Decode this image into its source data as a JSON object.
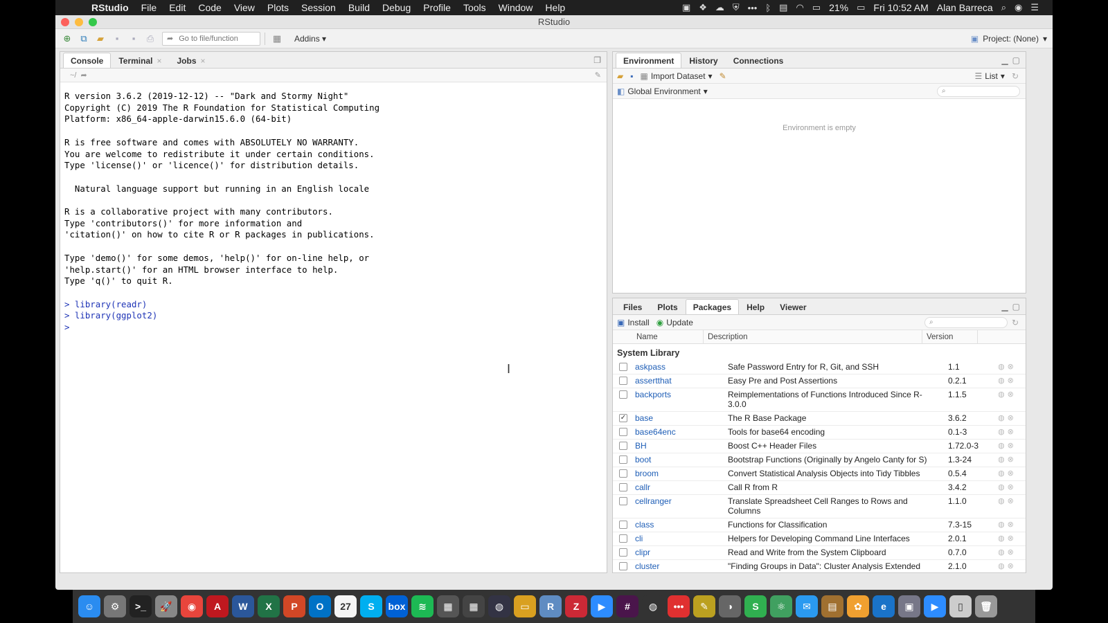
{
  "menubar": {
    "app": "RStudio",
    "items": [
      "File",
      "Edit",
      "Code",
      "View",
      "Plots",
      "Session",
      "Build",
      "Debug",
      "Profile",
      "Tools",
      "Window",
      "Help"
    ],
    "battery": "21%",
    "clock": "Fri 10:52 AM",
    "user": "Alan Barreca"
  },
  "window": {
    "title": "RStudio"
  },
  "toolbar": {
    "goto_placeholder": "Go to file/function",
    "addins": "Addins",
    "project": "Project: (None)"
  },
  "console": {
    "tabs": [
      {
        "label": "Console",
        "closable": false
      },
      {
        "label": "Terminal",
        "closable": true
      },
      {
        "label": "Jobs",
        "closable": true
      }
    ],
    "path": "~/",
    "startup_lines": [
      "R version 3.6.2 (2019-12-12) -- \"Dark and Stormy Night\"",
      "Copyright (C) 2019 The R Foundation for Statistical Computing",
      "Platform: x86_64-apple-darwin15.6.0 (64-bit)",
      "",
      "R is free software and comes with ABSOLUTELY NO WARRANTY.",
      "You are welcome to redistribute it under certain conditions.",
      "Type 'license()' or 'licence()' for distribution details.",
      "",
      "  Natural language support but running in an English locale",
      "",
      "R is a collaborative project with many contributors.",
      "Type 'contributors()' for more information and",
      "'citation()' on how to cite R or R packages in publications.",
      "",
      "Type 'demo()' for some demos, 'help()' for on-line help, or",
      "'help.start()' for an HTML browser interface to help.",
      "Type 'q()' to quit R.",
      ""
    ],
    "commands": [
      "> library(readr)",
      "> library(ggplot2)",
      ">"
    ]
  },
  "environment": {
    "tabs": [
      "Environment",
      "History",
      "Connections"
    ],
    "import_dataset": "Import Dataset",
    "view_mode": "List",
    "scope": "Global Environment",
    "empty_message": "Environment is empty"
  },
  "packages": {
    "tabs": [
      "Files",
      "Plots",
      "Packages",
      "Help",
      "Viewer"
    ],
    "install": "Install",
    "update": "Update",
    "columns": [
      "Name",
      "Description",
      "Version"
    ],
    "section": "System Library",
    "rows": [
      {
        "name": "askpass",
        "desc": "Safe Password Entry for R, Git, and SSH",
        "ver": "1.1",
        "checked": false
      },
      {
        "name": "assertthat",
        "desc": "Easy Pre and Post Assertions",
        "ver": "0.2.1",
        "checked": false
      },
      {
        "name": "backports",
        "desc": "Reimplementations of Functions Introduced Since R-3.0.0",
        "ver": "1.1.5",
        "checked": false
      },
      {
        "name": "base",
        "desc": "The R Base Package",
        "ver": "3.6.2",
        "checked": true
      },
      {
        "name": "base64enc",
        "desc": "Tools for base64 encoding",
        "ver": "0.1-3",
        "checked": false
      },
      {
        "name": "BH",
        "desc": "Boost C++ Header Files",
        "ver": "1.72.0-3",
        "checked": false
      },
      {
        "name": "boot",
        "desc": "Bootstrap Functions (Originally by Angelo Canty for S)",
        "ver": "1.3-24",
        "checked": false
      },
      {
        "name": "broom",
        "desc": "Convert Statistical Analysis Objects into Tidy Tibbles",
        "ver": "0.5.4",
        "checked": false
      },
      {
        "name": "callr",
        "desc": "Call R from R",
        "ver": "3.4.2",
        "checked": false
      },
      {
        "name": "cellranger",
        "desc": "Translate Spreadsheet Cell Ranges to Rows and Columns",
        "ver": "1.1.0",
        "checked": false
      },
      {
        "name": "class",
        "desc": "Functions for Classification",
        "ver": "7.3-15",
        "checked": false
      },
      {
        "name": "cli",
        "desc": "Helpers for Developing Command Line Interfaces",
        "ver": "2.0.1",
        "checked": false
      },
      {
        "name": "clipr",
        "desc": "Read and Write from the System Clipboard",
        "ver": "0.7.0",
        "checked": false
      },
      {
        "name": "cluster",
        "desc": "\"Finding Groups in Data\": Cluster Analysis Extended",
        "ver": "2.1.0",
        "checked": false
      }
    ]
  },
  "dock": {
    "apps": [
      {
        "name": "finder",
        "glyph": "☺",
        "color": "#2a8cf0"
      },
      {
        "name": "system-preferences",
        "glyph": "⚙",
        "color": "#777"
      },
      {
        "name": "terminal",
        "glyph": ">_",
        "color": "#222"
      },
      {
        "name": "launchpad",
        "glyph": "🚀",
        "color": "#888"
      },
      {
        "name": "chrome",
        "glyph": "◉",
        "color": "#e8453c"
      },
      {
        "name": "acrobat",
        "glyph": "A",
        "color": "#c0181f"
      },
      {
        "name": "word",
        "glyph": "W",
        "color": "#2b579a"
      },
      {
        "name": "excel",
        "glyph": "X",
        "color": "#217346"
      },
      {
        "name": "powerpoint",
        "glyph": "P",
        "color": "#d24726"
      },
      {
        "name": "outlook",
        "glyph": "O",
        "color": "#0072c6"
      },
      {
        "name": "calendar",
        "glyph": "27",
        "color": "#f5f5f5"
      },
      {
        "name": "skype",
        "glyph": "S",
        "color": "#00aff0"
      },
      {
        "name": "box",
        "glyph": "box",
        "color": "#0061d5"
      },
      {
        "name": "spotify",
        "glyph": "≋",
        "color": "#1db954"
      },
      {
        "name": "grid-app",
        "glyph": "▦",
        "color": "#555"
      },
      {
        "name": "grid-app-2",
        "glyph": "▦",
        "color": "#444"
      },
      {
        "name": "globe",
        "glyph": "◍",
        "color": "#334"
      },
      {
        "name": "bus",
        "glyph": "▭",
        "color": "#d9a020"
      },
      {
        "name": "r-app",
        "glyph": "R",
        "color": "#5f8cc2"
      },
      {
        "name": "zotero",
        "glyph": "Z",
        "color": "#cc2936"
      },
      {
        "name": "zoom",
        "glyph": "▶",
        "color": "#2d8cff"
      },
      {
        "name": "slack",
        "glyph": "#",
        "color": "#4a154b"
      },
      {
        "name": "globe-2",
        "glyph": "◍",
        "color": "#333"
      },
      {
        "name": "dots",
        "glyph": "•••",
        "color": "#e03030"
      },
      {
        "name": "pen",
        "glyph": "✎",
        "color": "#bba020"
      },
      {
        "name": "switch",
        "glyph": "◑",
        "color": "#666"
      },
      {
        "name": "s-app",
        "glyph": "S",
        "color": "#30b050"
      },
      {
        "name": "atom",
        "glyph": "⚛",
        "color": "#40a060"
      },
      {
        "name": "messages",
        "glyph": "✉",
        "color": "#2a9af0"
      },
      {
        "name": "notes",
        "glyph": "▤",
        "color": "#a07030"
      },
      {
        "name": "photos",
        "glyph": "✿",
        "color": "#f0a030"
      },
      {
        "name": "edge",
        "glyph": "e",
        "color": "#1a73c8"
      },
      {
        "name": "preview",
        "glyph": "▣",
        "color": "#778"
      },
      {
        "name": "zoom-2",
        "glyph": "▶",
        "color": "#2d8cff"
      },
      {
        "name": "document",
        "glyph": "▯",
        "color": "#ccc"
      },
      {
        "name": "trash",
        "glyph": "🗑",
        "color": "#999"
      }
    ]
  }
}
